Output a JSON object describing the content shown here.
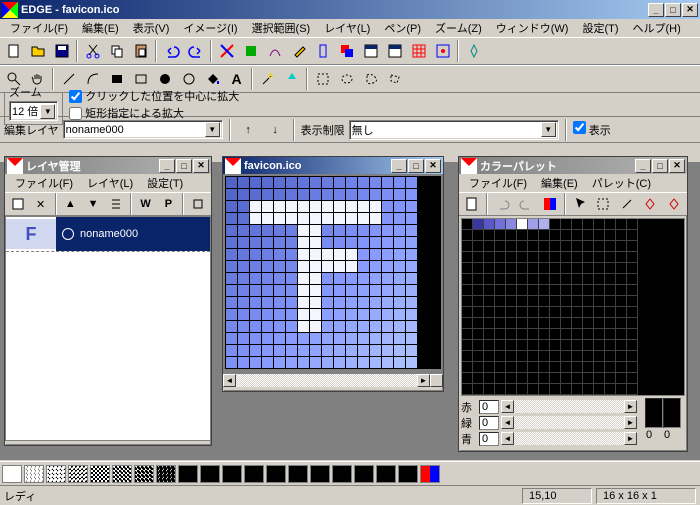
{
  "app": {
    "title": "EDGE - favicon.ico"
  },
  "menu": {
    "file": "ファイル(F)",
    "edit": "編集(E)",
    "view": "表示(V)",
    "image": "イメージ(I)",
    "select": "選択範囲(S)",
    "layer": "レイヤ(L)",
    "pen": "ペン(P)",
    "zoom": "ズーム(Z)",
    "window": "ウィンドウ(W)",
    "settings": "設定(T)",
    "help": "ヘルプ(H)"
  },
  "zoom": {
    "group_label": "ズーム",
    "value": "12 倍",
    "check1": "クリックした位置を中心に拡大",
    "check2": "矩形指定による拡大"
  },
  "layerbar": {
    "label": "編集レイヤ",
    "current": "noname000",
    "limit_label": "表示制限",
    "limit_value": "無し",
    "show_btn": "表示"
  },
  "panels": {
    "layer_mgr": {
      "title": "レイヤ管理",
      "menu_file": "ファイル(F)",
      "menu_layer": "レイヤ(L)",
      "menu_settings": "設定(T)",
      "item_name": "noname000"
    },
    "canvas": {
      "title": "favicon.ico"
    },
    "palette": {
      "title": "カラーパレット",
      "menu_file": "ファイル(F)",
      "menu_edit": "編集(E)",
      "menu_palette": "パレット(C)",
      "r_label": "赤",
      "g_label": "緑",
      "b_label": "青",
      "r_val": "0",
      "g_val": "0",
      "b_val": "0",
      "count": "0"
    }
  },
  "status": {
    "ready": "レディ",
    "coords": "15,10",
    "info": "16 x 16 x 1"
  },
  "palette_colors": [
    "#000000",
    "#3838a0",
    "#5858c8",
    "#ffffff",
    "#ff0000",
    "#0000ff",
    "#000000",
    "#000000",
    "#000000",
    "#000000",
    "#000000",
    "#000000",
    "#000000",
    "#000000",
    "#000000",
    "#000000"
  ]
}
